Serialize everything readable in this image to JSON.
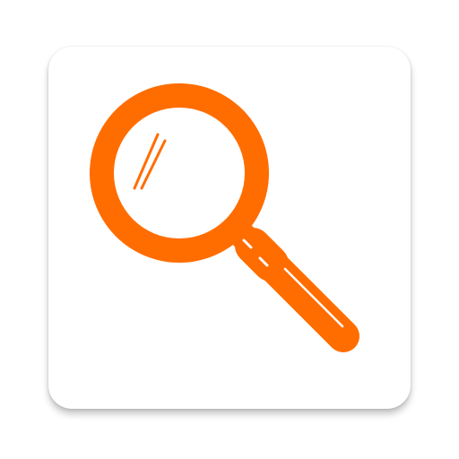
{
  "app_icon": {
    "icon": "magnifying-glass-icon",
    "colors": {
      "background": "#ffffff",
      "glyph": "#ff6d00",
      "lens": "#ffffff"
    }
  }
}
